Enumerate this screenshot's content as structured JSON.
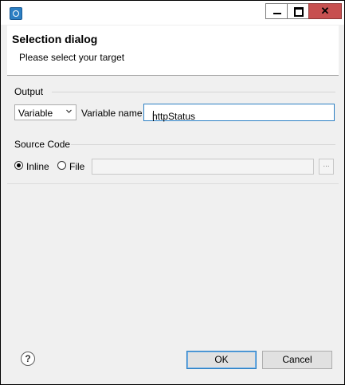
{
  "window": {
    "title": ""
  },
  "header": {
    "title": "Selection dialog",
    "subtitle": "Please select your target"
  },
  "output_group": {
    "label": "Output",
    "type_select": {
      "value": "Variable"
    },
    "var_name_label": "Variable name",
    "var_name_value": "httpStatus"
  },
  "source_group": {
    "label": "Source Code",
    "options": [
      {
        "label": "Inline",
        "checked": true
      },
      {
        "label": "File",
        "checked": false
      }
    ],
    "file_path_value": "",
    "browse_label": "..."
  },
  "footer": {
    "help_label": "?",
    "ok_label": "OK",
    "cancel_label": "Cancel"
  },
  "colors": {
    "accent": "#2c7fc3",
    "close_button": "#c75050"
  }
}
